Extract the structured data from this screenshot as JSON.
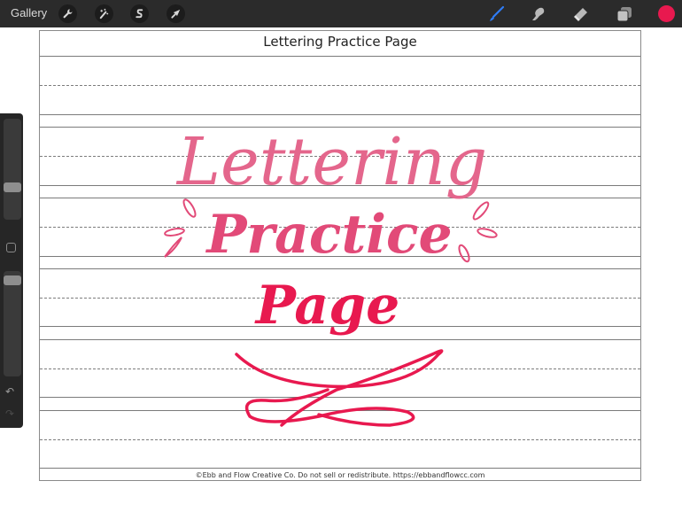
{
  "toolbar": {
    "gallery_label": "Gallery",
    "left_tools": [
      {
        "name": "actions",
        "icon": "wrench-icon"
      },
      {
        "name": "adjustments",
        "icon": "magic-wand-icon"
      },
      {
        "name": "selection",
        "icon": "selection-s-icon"
      },
      {
        "name": "transform",
        "icon": "arrow-cursor-icon"
      }
    ],
    "right_tools": [
      {
        "name": "brush",
        "icon": "brush-icon",
        "active": true
      },
      {
        "name": "smudge",
        "icon": "smudge-icon"
      },
      {
        "name": "eraser",
        "icon": "eraser-icon"
      },
      {
        "name": "layers",
        "icon": "layers-icon"
      }
    ],
    "current_color": "#e8194f",
    "active_tool_color": "#2f7cf6"
  },
  "sidebar": {
    "brush_size_level": 0.3,
    "opacity_level": 0.95,
    "undo_label": "undo",
    "redo_label": "redo"
  },
  "canvas": {
    "title": "Lettering Practice Page",
    "artwork_words": [
      "Lettering",
      "Practice",
      "Page"
    ],
    "artwork_colors": {
      "top": "#e4668c",
      "middle": "#e24a78",
      "bottom": "#e8194f"
    },
    "footer": "©Ebb and Flow Creative Co. Do not sell or redistribute. https://ebbandflowcc.com"
  }
}
